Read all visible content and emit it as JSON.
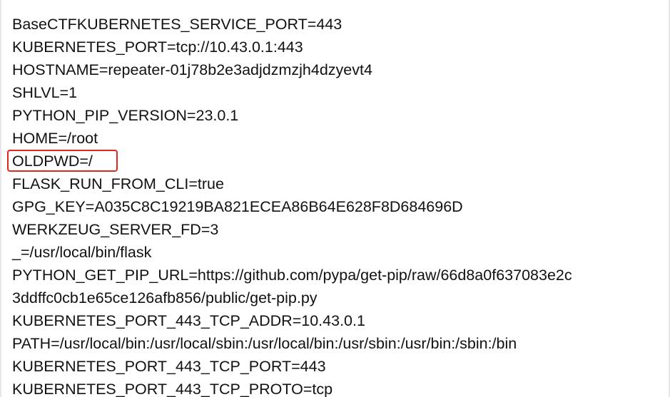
{
  "env_lines": [
    "BaseCTFKUBERNETES_SERVICE_PORT=443",
    "KUBERNETES_PORT=tcp://10.43.0.1:443",
    "HOSTNAME=repeater-01j78b2e3adjdzmzjh4dzyevt4",
    "SHLVL=1",
    "PYTHON_PIP_VERSION=23.0.1",
    "HOME=/root",
    "OLDPWD=/",
    "FLASK_RUN_FROM_CLI=true",
    "GPG_KEY=A035C8C19219BA821ECEA86B64E628F8D684696D",
    "WERKZEUG_SERVER_FD=3",
    "_=/usr/local/bin/flask",
    "PYTHON_GET_PIP_URL=https://github.com/pypa/get-pip/raw/66d8a0f637083e2c",
    "3ddffc0cb1e65ce126afb856/public/get-pip.py",
    "KUBERNETES_PORT_443_TCP_ADDR=10.43.0.1",
    "PATH=/usr/local/bin:/usr/local/sbin:/usr/local/bin:/usr/sbin:/usr/bin:/sbin:/bin",
    "KUBERNETES_PORT_443_TCP_PORT=443",
    "KUBERNETES_PORT_443_TCP_PROTO=tcp"
  ],
  "highlight": {
    "line_index": 6,
    "color": "#e0261f"
  }
}
